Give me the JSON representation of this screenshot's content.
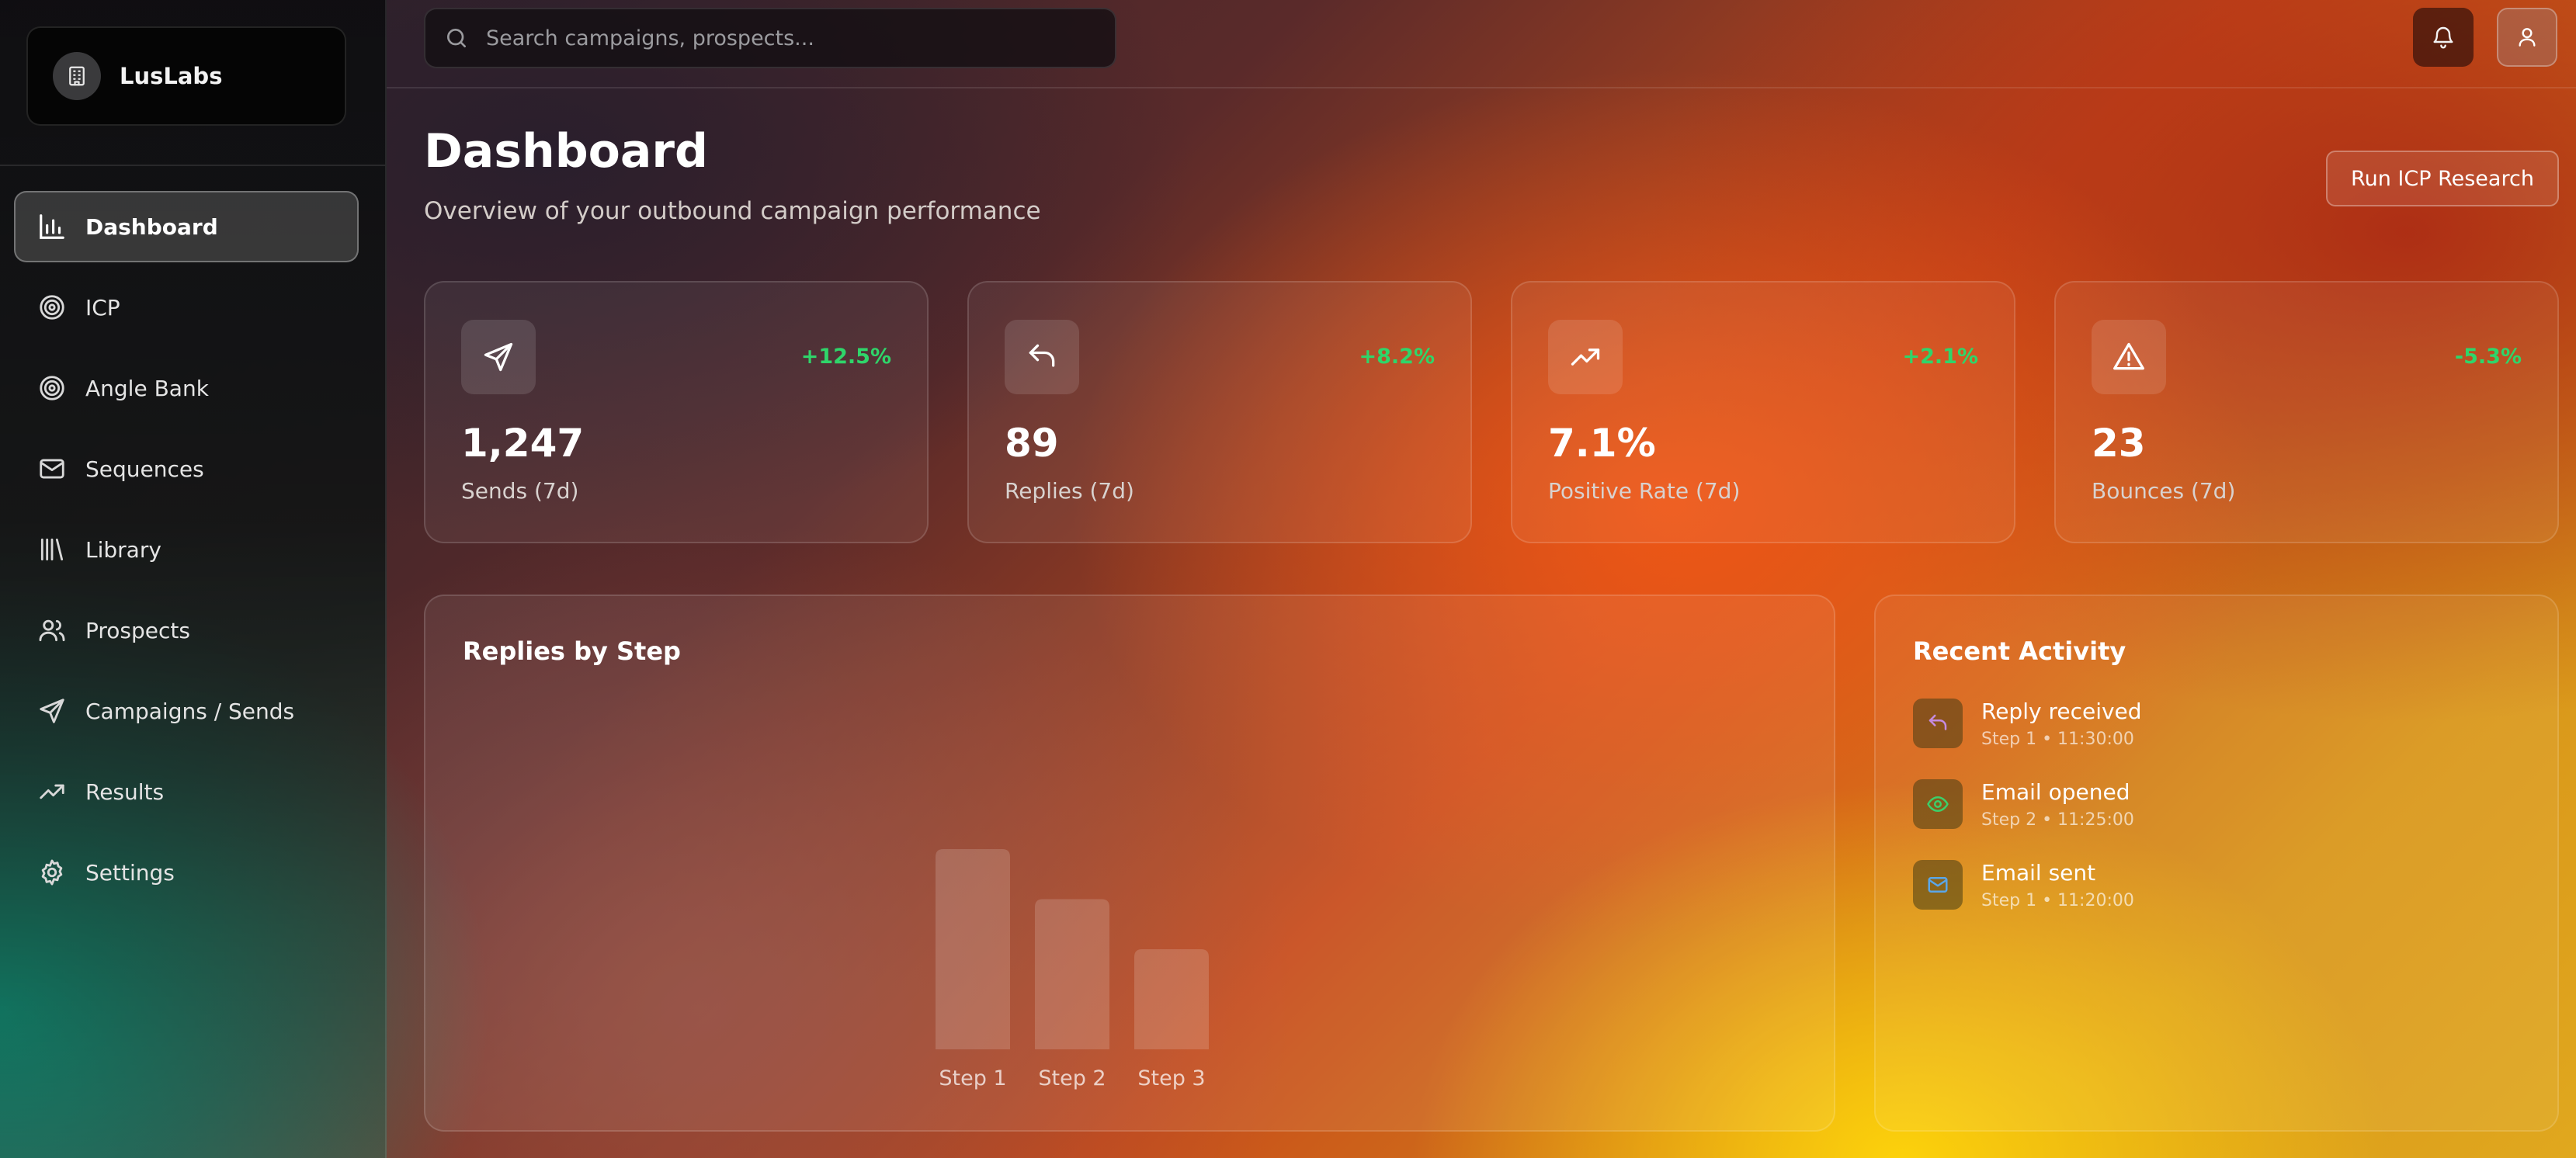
{
  "brand": {
    "name": "LusLabs",
    "logo_icon": "building-icon"
  },
  "sidebar": {
    "items": [
      {
        "label": "Dashboard",
        "icon": "bar-chart-icon",
        "active": true
      },
      {
        "label": "ICP",
        "icon": "target-icon",
        "active": false
      },
      {
        "label": "Angle Bank",
        "icon": "target-icon",
        "active": false
      },
      {
        "label": "Sequences",
        "icon": "mail-icon",
        "active": false
      },
      {
        "label": "Library",
        "icon": "library-icon",
        "active": false
      },
      {
        "label": "Prospects",
        "icon": "users-icon",
        "active": false
      },
      {
        "label": "Campaigns / Sends",
        "icon": "send-icon",
        "active": false
      },
      {
        "label": "Results",
        "icon": "trending-up-icon",
        "active": false
      },
      {
        "label": "Settings",
        "icon": "gear-icon",
        "active": false
      }
    ]
  },
  "topbar": {
    "search_placeholder": "Search campaigns, prospects...",
    "notifications_icon": "bell-icon",
    "user_icon": "user-icon"
  },
  "header": {
    "title": "Dashboard",
    "subtitle": "Overview of your outbound campaign performance",
    "action_label": "Run ICP Research"
  },
  "stats": [
    {
      "value": "1,247",
      "label": "Sends (7d)",
      "change": "+12.5%",
      "icon": "send-icon"
    },
    {
      "value": "89",
      "label": "Replies (7d)",
      "change": "+8.2%",
      "icon": "reply-icon"
    },
    {
      "value": "7.1%",
      "label": "Positive Rate (7d)",
      "change": "+2.1%",
      "icon": "trending-up-icon"
    },
    {
      "value": "23",
      "label": "Bounces (7d)",
      "change": "-5.3%",
      "icon": "alert-triangle-icon"
    }
  ],
  "chart": {
    "title": "Replies by Step"
  },
  "chart_data": {
    "type": "bar",
    "title": "Replies by Step",
    "categories": [
      "Step 1",
      "Step 2",
      "Step 3"
    ],
    "values": [
      40,
      30,
      20
    ],
    "ylim": [
      0,
      40
    ],
    "grid": false,
    "legend": "none"
  },
  "activity": {
    "title": "Recent Activity",
    "items": [
      {
        "title": "Reply received",
        "meta": "Step 1 • 11:30:00",
        "icon": "reply-icon",
        "color": "#c58be0"
      },
      {
        "title": "Email opened",
        "meta": "Step 2 • 11:25:00",
        "icon": "eye-icon",
        "color": "#3ccf6a"
      },
      {
        "title": "Email sent",
        "meta": "Step 1 • 11:20:00",
        "icon": "mail-icon",
        "color": "#5aa6e8"
      }
    ]
  },
  "colors": {
    "positive": "#2fd56a",
    "accent": "#f0581a"
  }
}
